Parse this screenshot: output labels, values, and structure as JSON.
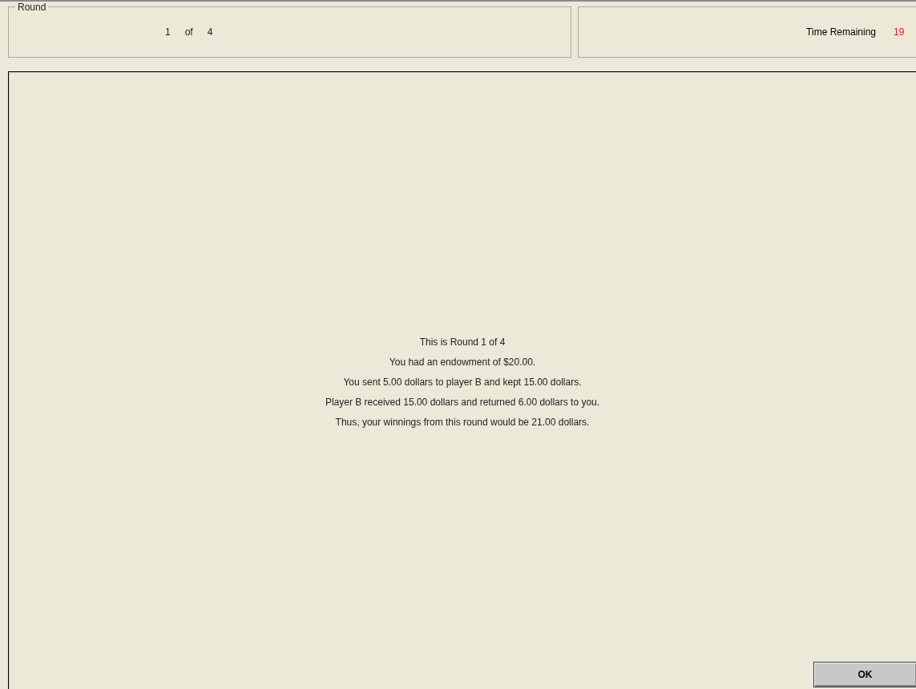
{
  "round_panel": {
    "title": "Round",
    "current": "1",
    "of": "of",
    "total": "4"
  },
  "timer_panel": {
    "label": "Time Remaining",
    "value": "19"
  },
  "messages": [
    "This is Round 1  of 4",
    "You had an endowment of $20.00.",
    "You sent 5.00 dollars to player B and kept 15.00 dollars.",
    "Player B received 15.00 dollars and returned 6.00 dollars to you.",
    "Thus, your winnings from this round would be 21.00 dollars."
  ],
  "ok_button": "OK"
}
